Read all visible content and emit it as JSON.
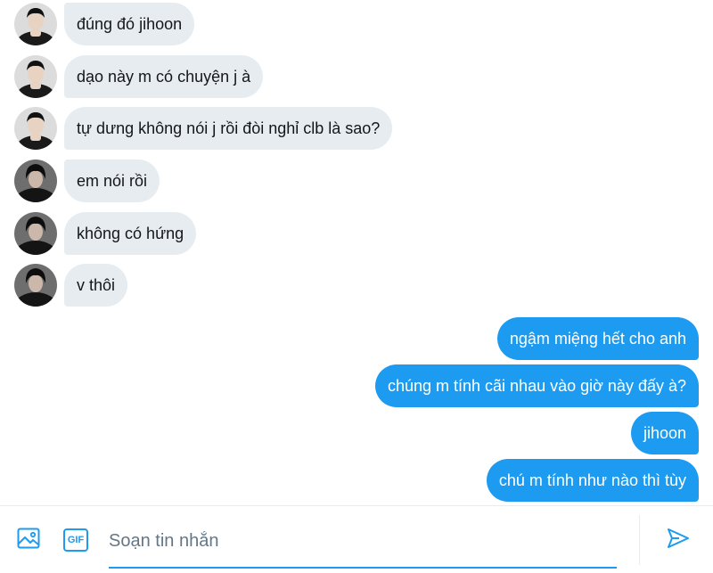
{
  "conversation": {
    "incoming": [
      {
        "text": "đúng đó jihoon",
        "avatar": "avatar-a"
      },
      {
        "text": "dạo này m có chuyện j à",
        "avatar": "avatar-a"
      },
      {
        "text": "tự dưng không nói j rồi đòi nghỉ clb là sao?",
        "avatar": "avatar-a"
      },
      {
        "text": "em nói rồi",
        "avatar": "avatar-b"
      },
      {
        "text": "không có hứng",
        "avatar": "avatar-b"
      },
      {
        "text": "v thôi",
        "avatar": "avatar-b"
      }
    ],
    "outgoing": [
      {
        "text": "ngậm miệng hết cho anh"
      },
      {
        "text": "chúng m tính cãi nhau vào giờ này đấy à?"
      },
      {
        "text": "jihoon"
      },
      {
        "text": "chú m tính như nào thì tùy"
      }
    ]
  },
  "composer": {
    "placeholder": "Soạn tin nhắn",
    "value": "",
    "gif_label": "GIF",
    "image_icon": "image-icon",
    "send_icon": "send-icon"
  },
  "colors": {
    "incoming_bubble": "#e6ecf0",
    "outgoing_bubble": "#1d9bf0",
    "accent": "#1d9bf0"
  }
}
